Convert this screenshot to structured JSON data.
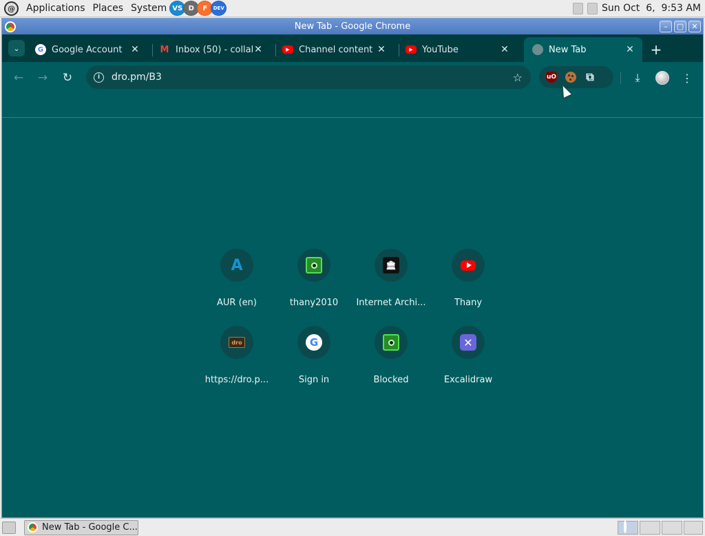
{
  "top_panel": {
    "menus": [
      "Applications",
      "Places",
      "System"
    ],
    "launchers": [
      {
        "name": "vscode-icon",
        "glyph": "VS",
        "color": "#1b8ad1"
      },
      {
        "name": "dbeaver-icon",
        "glyph": "D",
        "color": "#6b6b6b"
      },
      {
        "name": "firefox-icon",
        "glyph": "F",
        "color": "#ff6f2a"
      },
      {
        "name": "firefox-dev-icon",
        "glyph": "DEV",
        "color": "#2a6fdb"
      }
    ],
    "clock": "Sun Oct  6,  9:53 AM"
  },
  "window": {
    "title": "New Tab - Google Chrome",
    "buttons": {
      "minimize": "–",
      "maximize": "▢",
      "close": "✕"
    }
  },
  "tabs": [
    {
      "label": "Google Account",
      "icon": "google-icon",
      "active": false
    },
    {
      "label": "Inbox (50) - collab",
      "icon": "gmail-icon",
      "active": false
    },
    {
      "label": "Channel content -",
      "icon": "youtube-icon",
      "active": false
    },
    {
      "label": "YouTube",
      "icon": "youtube-icon",
      "active": false
    },
    {
      "label": "New Tab",
      "icon": "globe-icon",
      "active": true
    }
  ],
  "toolbar": {
    "url": "dro.pm/B3",
    "back": "←",
    "forward": "→",
    "reload": "↻",
    "info": "i",
    "star": "☆",
    "ublock": "uO",
    "extensions": "⧉",
    "download": "⤓",
    "menu": "⋮"
  },
  "shortcuts": [
    {
      "label": "AUR (en)",
      "icon": "aur-icon",
      "glyph": "A"
    },
    {
      "label": "thany2010",
      "icon": "green-eye-icon",
      "glyph": ""
    },
    {
      "label": "Internet Archi...",
      "icon": "internet-archive-icon",
      "glyph": "🏛"
    },
    {
      "label": "Thany",
      "icon": "youtube-icon",
      "glyph": ""
    },
    {
      "label": "https://dro.p...",
      "icon": "dro-pm-icon",
      "glyph": "dro"
    },
    {
      "label": "Sign in",
      "icon": "google-icon",
      "glyph": "G"
    },
    {
      "label": "Blocked",
      "icon": "green-eye-icon",
      "glyph": ""
    },
    {
      "label": "Excalidraw",
      "icon": "excalidraw-icon",
      "glyph": "✕"
    }
  ],
  "taskbar": {
    "window_button": "New Tab - Google C..."
  },
  "colors": {
    "theme_background": "#005c5f",
    "tabstrip": "#003b3e",
    "omnibox": "#0a4a4d",
    "titlebar": "#5a86c9"
  }
}
